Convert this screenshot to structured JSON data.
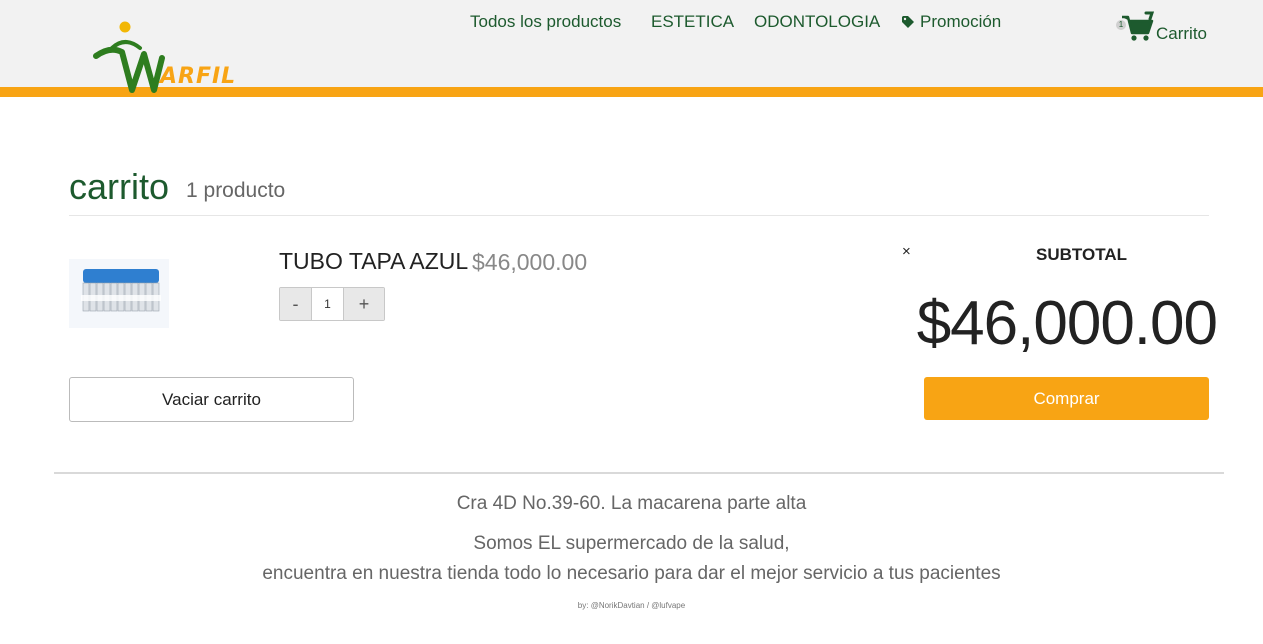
{
  "brand": {
    "logo_text": "ARFIL"
  },
  "nav": {
    "items": [
      "Todos los productos",
      "ESTETICA",
      "ODONTOLOGIA"
    ],
    "promo": "Promoción",
    "cart_label": "Carrito",
    "cart_count": "1"
  },
  "cart": {
    "title": "carrito",
    "count_label": "1 producto",
    "item": {
      "name": "TUBO TAPA AZUL",
      "price": "$46,000.00",
      "quantity": "1",
      "minus": "-",
      "plus": "+",
      "remove": "×"
    },
    "subtotal_label": "SUBTOTAL",
    "subtotal_value": "$46,000.00",
    "empty_button": "Vaciar carrito",
    "buy_button": "Comprar"
  },
  "footer": {
    "address": "Cra 4D No.39-60. La macarena parte alta",
    "tagline1": "Somos EL supermercado de la salud,",
    "tagline2": "encuentra en nuestra tienda todo lo necesario para dar el mejor servicio a tus pacientes",
    "credits": "by: @NorikDavtian / @lufvape"
  },
  "colors": {
    "accent": "#f8a414",
    "brand_green": "#1d5a2e"
  }
}
